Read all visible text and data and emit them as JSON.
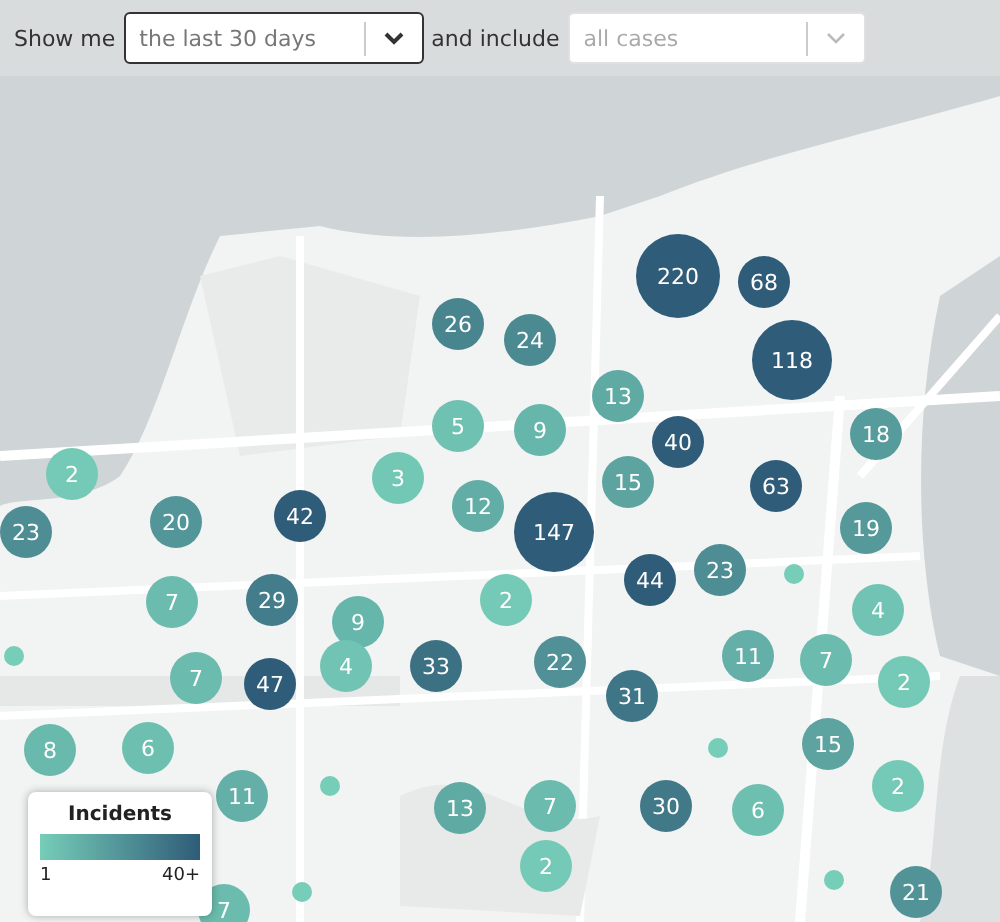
{
  "filter_bar": {
    "prefix": "Show me",
    "selects": [
      {
        "value": "the last 30 days",
        "disabled": false
      },
      {
        "value": "all cases",
        "disabled": true
      }
    ],
    "joiner": "and include"
  },
  "markers": [
    {
      "kind": "cluster",
      "count": "220"
    },
    {
      "kind": "cluster",
      "count": "68"
    },
    {
      "kind": "cluster",
      "count": "26"
    },
    {
      "kind": "cluster",
      "count": "24"
    },
    {
      "kind": "cluster",
      "count": "118"
    },
    {
      "kind": "cluster",
      "count": "5"
    },
    {
      "kind": "cluster",
      "count": "9"
    },
    {
      "kind": "cluster",
      "count": "13"
    },
    {
      "kind": "cluster",
      "count": "40"
    },
    {
      "kind": "cluster",
      "count": "18"
    },
    {
      "kind": "cluster",
      "count": "23"
    },
    {
      "kind": "cluster",
      "count": "2"
    },
    {
      "kind": "cluster",
      "count": "20"
    },
    {
      "kind": "cluster",
      "count": "42"
    },
    {
      "kind": "cluster",
      "count": "3"
    },
    {
      "kind": "cluster",
      "count": "12"
    },
    {
      "kind": "cluster",
      "count": "147"
    },
    {
      "kind": "cluster",
      "count": "15"
    },
    {
      "kind": "cluster",
      "count": "63"
    },
    {
      "kind": "cluster",
      "count": "19"
    },
    {
      "kind": "cluster",
      "count": "7"
    },
    {
      "kind": "cluster",
      "count": "29"
    },
    {
      "kind": "cluster",
      "count": "9"
    },
    {
      "kind": "cluster",
      "count": "2"
    },
    {
      "kind": "cluster",
      "count": "44"
    },
    {
      "kind": "cluster",
      "count": "23"
    },
    {
      "kind": "dot"
    },
    {
      "kind": "cluster",
      "count": "4"
    },
    {
      "kind": "dot"
    },
    {
      "kind": "cluster",
      "count": "7"
    },
    {
      "kind": "cluster",
      "count": "47"
    },
    {
      "kind": "cluster",
      "count": "4"
    },
    {
      "kind": "cluster",
      "count": "33"
    },
    {
      "kind": "cluster",
      "count": "22"
    },
    {
      "kind": "cluster",
      "count": "31"
    },
    {
      "kind": "cluster",
      "count": "11"
    },
    {
      "kind": "cluster",
      "count": "7"
    },
    {
      "kind": "cluster",
      "count": "2"
    },
    {
      "kind": "cluster",
      "count": "8"
    },
    {
      "kind": "cluster",
      "count": "6"
    },
    {
      "kind": "cluster",
      "count": "11"
    },
    {
      "kind": "dot"
    },
    {
      "kind": "cluster",
      "count": "13"
    },
    {
      "kind": "cluster",
      "count": "7"
    },
    {
      "kind": "cluster",
      "count": "30"
    },
    {
      "kind": "dot"
    },
    {
      "kind": "cluster",
      "count": "6"
    },
    {
      "kind": "cluster",
      "count": "15"
    },
    {
      "kind": "cluster",
      "count": "2"
    },
    {
      "kind": "cluster",
      "count": "7"
    },
    {
      "kind": "dot"
    },
    {
      "kind": "cluster",
      "count": "2"
    },
    {
      "kind": "dot"
    },
    {
      "kind": "cluster",
      "count": "21"
    }
  ],
  "legend": {
    "title": "Incidents",
    "min": "1",
    "max": "40+"
  }
}
